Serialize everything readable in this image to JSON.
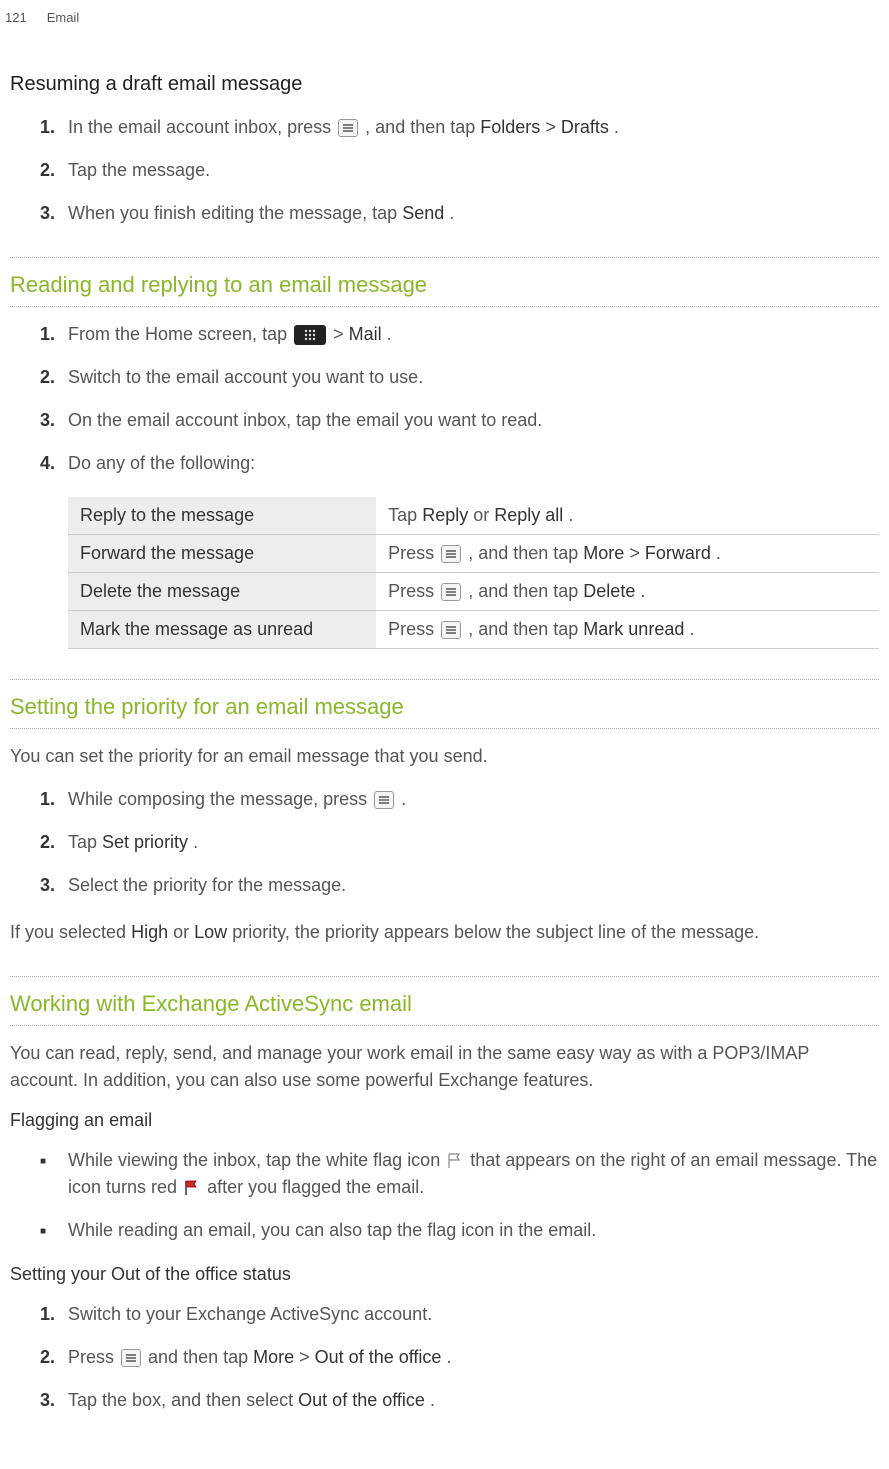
{
  "header": {
    "page_number": "121",
    "title": "Email"
  },
  "section1": {
    "heading": "Resuming a draft email message",
    "steps": [
      {
        "pre": "In the email account inbox, press ",
        "post": ", and then tap ",
        "bold1": "Folders",
        "sep": " > ",
        "bold2": "Drafts",
        "end": "."
      },
      {
        "text": "Tap the message."
      },
      {
        "pre": "When you finish editing the message, tap ",
        "bold1": "Send",
        "end": "."
      }
    ]
  },
  "section2": {
    "heading": "Reading and replying to an email message",
    "steps": [
      {
        "pre": "From the Home screen, tap ",
        "post": " > ",
        "bold1": "Mail",
        "end": "."
      },
      {
        "text": "Switch to the email account you want to use."
      },
      {
        "text": "On the email account inbox, tap the email you want to read."
      },
      {
        "text": "Do any of the following:"
      }
    ],
    "table": [
      {
        "label": "Reply to the message",
        "pre": "Tap ",
        "b1": "Reply",
        "mid": " or ",
        "b2": "Reply all",
        "end": "."
      },
      {
        "label": "Forward the message",
        "pre": "Press ",
        "mid": ", and then tap ",
        "b1": "More",
        "sep": " > ",
        "b2": "Forward",
        "end": "."
      },
      {
        "label": "Delete the message",
        "pre": "Press ",
        "mid": ", and then tap ",
        "b1": "Delete",
        "end": "."
      },
      {
        "label": "Mark the message as unread",
        "pre": "Press ",
        "mid": ", and then tap ",
        "b1": "Mark unread",
        "end": "."
      }
    ]
  },
  "section3": {
    "heading": "Setting the priority for an email message",
    "intro": "You can set the priority for an email message that you send.",
    "steps": [
      {
        "pre": "While composing the message, press ",
        "end": "."
      },
      {
        "pre": "Tap ",
        "bold1": "Set priority",
        "end": "."
      },
      {
        "text": "Select the priority for the message."
      }
    ],
    "outro_pre": "If you selected ",
    "outro_b1": "High",
    "outro_mid": " or ",
    "outro_b2": "Low",
    "outro_post": " priority, the priority appears below the subject line of the message."
  },
  "section4": {
    "heading": "Working with Exchange ActiveSync email",
    "intro": "You can read, reply, send, and manage your work email in the same easy way as with a POP3/IMAP account. In addition, you can also use some powerful Exchange features.",
    "sub1_heading": "Flagging an email",
    "sub1_bullets": [
      {
        "pre": "While viewing the inbox, tap the white flag icon ",
        "mid": " that appears on the right of an email message. The icon turns red ",
        "post": " after you flagged the email."
      },
      {
        "text": "While reading an email, you can also tap the flag icon in the email."
      }
    ],
    "sub2_heading": "Setting your Out of the office status",
    "sub2_steps": [
      {
        "text": "Switch to your Exchange ActiveSync account."
      },
      {
        "pre": "Press ",
        "mid": " and then tap ",
        "b1": "More",
        "sep": " > ",
        "b2": "Out of the office",
        "end": "."
      },
      {
        "pre": "Tap the box, and then select ",
        "b1": "Out of the office",
        "end": "."
      }
    ]
  }
}
